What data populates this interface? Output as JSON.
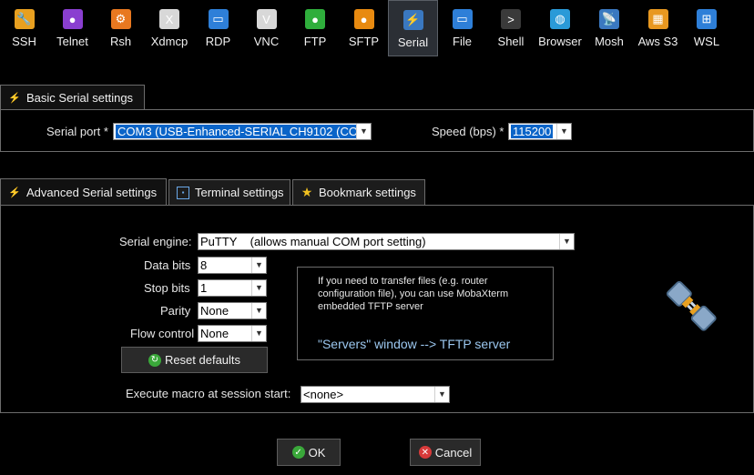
{
  "toolbar": [
    {
      "label": "SSH",
      "icon": "wrench-icon",
      "color": "#e8a020",
      "glyph": "🔧"
    },
    {
      "label": "Telnet",
      "icon": "telnet-icon",
      "color": "#8a3fd0",
      "glyph": "●"
    },
    {
      "label": "Rsh",
      "icon": "rsh-icon",
      "color": "#e87820",
      "glyph": "⚙"
    },
    {
      "label": "Xdmcp",
      "icon": "x-icon",
      "color": "#d8d8d8",
      "glyph": "X"
    },
    {
      "label": "RDP",
      "icon": "monitor-icon",
      "color": "#2e7fd8",
      "glyph": "▭"
    },
    {
      "label": "VNC",
      "icon": "vnc-icon",
      "color": "#d8d8d8",
      "glyph": "V"
    },
    {
      "label": "FTP",
      "icon": "globe-green-icon",
      "color": "#2fae3c",
      "glyph": "●"
    },
    {
      "label": "SFTP",
      "icon": "globe-orange-icon",
      "color": "#e88a10",
      "glyph": "●"
    },
    {
      "label": "Serial",
      "icon": "serial-plug-icon",
      "color": "#3a78c0",
      "glyph": "⚡"
    },
    {
      "label": "File",
      "icon": "file-monitor-icon",
      "color": "#2e7fd8",
      "glyph": "▭"
    },
    {
      "label": "Shell",
      "icon": "terminal-icon",
      "color": "#3a3a3a",
      "glyph": ">"
    },
    {
      "label": "Browser",
      "icon": "browser-globe-icon",
      "color": "#2a9ad8",
      "glyph": "◍"
    },
    {
      "label": "Mosh",
      "icon": "satellite-icon",
      "color": "#3a78c0",
      "glyph": "📡"
    },
    {
      "label": "Aws S3",
      "icon": "aws-cubes-icon",
      "color": "#e89820",
      "glyph": "▦"
    },
    {
      "label": "WSL",
      "icon": "windows-icon",
      "color": "#2e7fd8",
      "glyph": "⊞"
    }
  ],
  "basic": {
    "tab_label": "Basic Serial settings",
    "port_label": "Serial port *",
    "port_value": "COM3  (USB-Enhanced-SERIAL CH9102 (CO",
    "speed_label": "Speed (bps) *",
    "speed_value": "115200"
  },
  "tabs": {
    "advanced": "Advanced Serial settings",
    "terminal": "Terminal settings",
    "bookmark": "Bookmark settings"
  },
  "advanced": {
    "engine_label": "Serial engine:",
    "engine_value": "PuTTY    (allows manual COM port setting)",
    "databits_label": "Data bits",
    "databits_value": "8",
    "stopbits_label": "Stop bits",
    "stopbits_value": "1",
    "parity_label": "Parity",
    "parity_value": "None",
    "flow_label": "Flow control",
    "flow_value": "None",
    "reset_label": "Reset defaults",
    "macro_label": "Execute macro at session start:",
    "macro_value": "<none>",
    "info_text": "If you need to transfer files (e.g. router configuration file), you can use MobaXterm embedded TFTP server",
    "info_link": "\"Servers\" window  -->  TFTP server"
  },
  "footer": {
    "ok_label": "OK",
    "cancel_label": "Cancel"
  },
  "colors": {
    "accent": "#0a64c8",
    "ok_green": "#3aa83a",
    "cancel_red": "#d83a3a",
    "link": "#9cc8f0"
  }
}
